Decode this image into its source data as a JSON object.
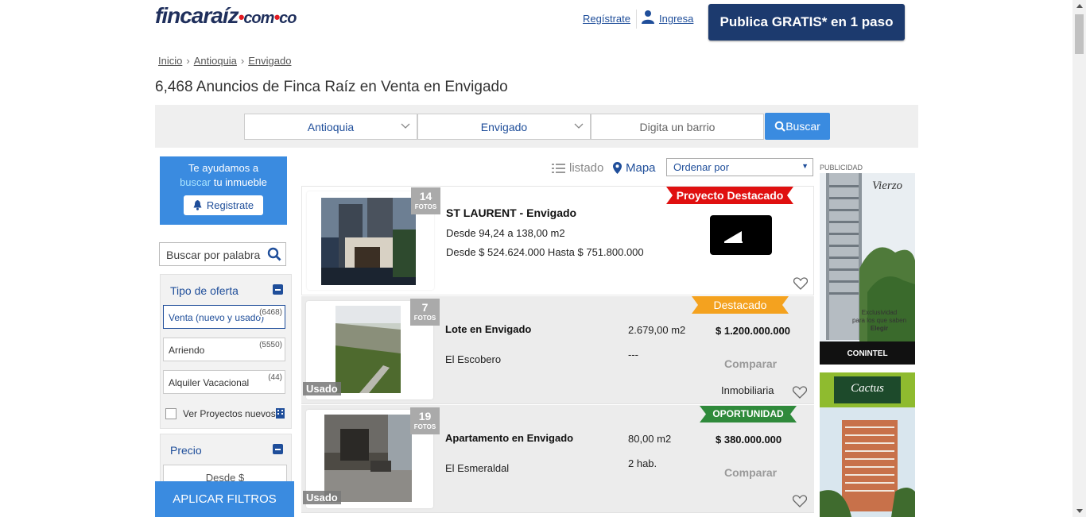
{
  "header": {
    "logo_main": "fincaraíz",
    "logo_com": "com",
    "logo_co": "co",
    "register_link": "Regístrate",
    "login_link": "Ingresa",
    "publish_button": "Publica GRATIS* en 1 paso"
  },
  "breadcrumb": [
    "Inicio",
    "Antioquia",
    "Envigado"
  ],
  "page_title": "6,468 Anuncios de Finca Raíz en Venta en Envigado",
  "search": {
    "department": "Antioquia",
    "city": "Envigado",
    "neighborhood_placeholder": "Digita un barrio",
    "button": "Buscar"
  },
  "sidebar": {
    "help_line1": "Te ayudamos a",
    "help_highlight": "buscar",
    "help_line2": " tu inmueble",
    "register_button": "Registrate",
    "keyword_placeholder": "Buscar por palabra",
    "offer_title": "Tipo de oferta",
    "offers": [
      {
        "label": "Venta (nuevo y usado)",
        "count": "(6468)"
      },
      {
        "label": "Arriendo",
        "count": "(5550)"
      },
      {
        "label": "Alquiler Vacacional",
        "count": "(44)"
      }
    ],
    "projects_checkbox": "Ver Proyectos nuevos",
    "price_title": "Precio",
    "price_from": "Desde $",
    "apply_button": "APLICAR FILTROS"
  },
  "view": {
    "list_label": "listado",
    "map_label": "Mapa",
    "order_label": "Ordenar por"
  },
  "listings": [
    {
      "photos": "14",
      "photos_label": "FOTOS",
      "ribbon": "Proyecto Destacado",
      "title": "ST LAURENT - Envigado",
      "area": "Desde 94,24 a 138,00 m2",
      "price": "Desde $ 524.624.000 Hasta $ 751.800.000"
    },
    {
      "photos": "7",
      "photos_label": "FOTOS",
      "tag": "Usado",
      "ribbon": "Destacado",
      "title": "Lote en Envigado",
      "location": "El Escobero",
      "area": "2.679,00 m2",
      "rooms": "---",
      "price": "$ 1.200.000.000",
      "compare": "Comparar",
      "seller": "Inmobiliaria"
    },
    {
      "photos": "19",
      "photos_label": "FOTOS",
      "tag": "Usado",
      "ribbon": "OPORTUNIDAD",
      "title": "Apartamento en Envigado",
      "location": "El Esmeraldal",
      "area": "80,00 m2",
      "rooms": "2 hab.",
      "price": "$ 380.000.000",
      "compare": "Comparar"
    }
  ],
  "ads": {
    "label": "PUBLICIDAD",
    "ad1_brand": "Vierzo",
    "ad1_line1": "Exclusividad",
    "ad1_line2": "para los que saben",
    "ad1_line3": "Elegir",
    "ad1_company": "CONINTEL",
    "ad2_brand": "Cactus"
  },
  "colors": {
    "brand_navy": "#1c3a6e",
    "link_blue": "#1f4e9a",
    "accent_blue": "#3a8be0",
    "ribbon_red": "#e01010",
    "ribbon_orange": "#f4a21f",
    "ribbon_green": "#2f8a3b"
  }
}
